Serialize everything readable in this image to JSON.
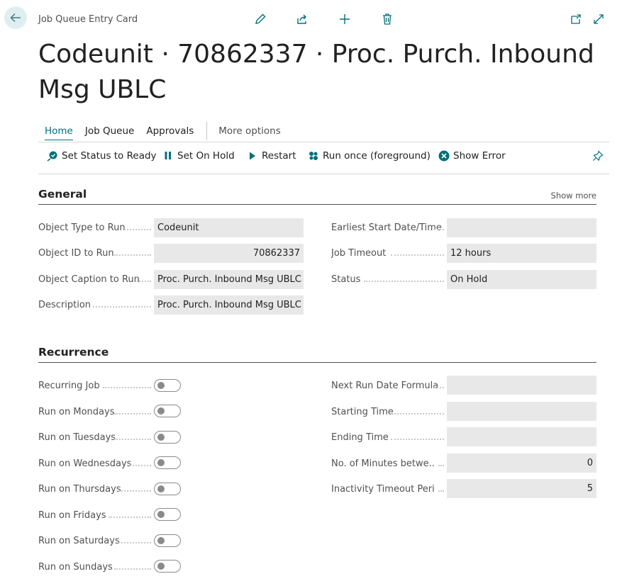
{
  "header": {
    "breadcrumb": "Job Queue Entry Card",
    "title": "Codeunit · 70862337 · Proc. Purch. Inbound Msg UBLC"
  },
  "tabs": [
    {
      "label": "Home",
      "active": true
    },
    {
      "label": "Job Queue"
    },
    {
      "label": "Approvals"
    },
    {
      "label": "More options"
    }
  ],
  "actions": [
    {
      "label": "Set Status to Ready",
      "icon": "status-ready-icon"
    },
    {
      "label": "Set On Hold",
      "icon": "pause-icon"
    },
    {
      "label": "Restart",
      "icon": "play-icon"
    },
    {
      "label": "Run once (foreground)",
      "icon": "run-once-icon"
    },
    {
      "label": "Show Error",
      "icon": "error-icon"
    }
  ],
  "general": {
    "title": "General",
    "show_more": "Show more",
    "left": [
      {
        "label": "Object Type to Run",
        "value": "Codeunit"
      },
      {
        "label": "Object ID to Run",
        "value": "70862337"
      },
      {
        "label": "Object Caption to Run",
        "value": "Proc. Purch. Inbound Msg UBLC"
      },
      {
        "label": "Description",
        "value": "Proc. Purch. Inbound Msg UBLC"
      }
    ],
    "right": [
      {
        "label": "Earliest Start Date/Time",
        "value": ""
      },
      {
        "label": "Job Timeout",
        "value": "12 hours"
      },
      {
        "label": "Status",
        "value": "On Hold"
      }
    ]
  },
  "recurrence": {
    "title": "Recurrence",
    "toggles": [
      {
        "label": "Recurring Job",
        "on": false
      },
      {
        "label": "Run on Mondays",
        "on": false
      },
      {
        "label": "Run on Tuesdays",
        "on": false
      },
      {
        "label": "Run on Wednesdays",
        "on": false
      },
      {
        "label": "Run on Thursdays",
        "on": false
      },
      {
        "label": "Run on Fridays",
        "on": false
      },
      {
        "label": "Run on Saturdays",
        "on": false
      },
      {
        "label": "Run on Sundays",
        "on": false
      }
    ],
    "right": [
      {
        "label": "Next Run Date Formula",
        "value": ""
      },
      {
        "label": "Starting Time",
        "value": ""
      },
      {
        "label": "Ending Time",
        "value": ""
      },
      {
        "label": "No. of Minutes betwe...",
        "value": "0"
      },
      {
        "label": "Inactivity Timeout Peri...",
        "value": "5"
      }
    ]
  },
  "colors": {
    "accent": "#00707a",
    "field_bg": "#e8e8e8"
  }
}
